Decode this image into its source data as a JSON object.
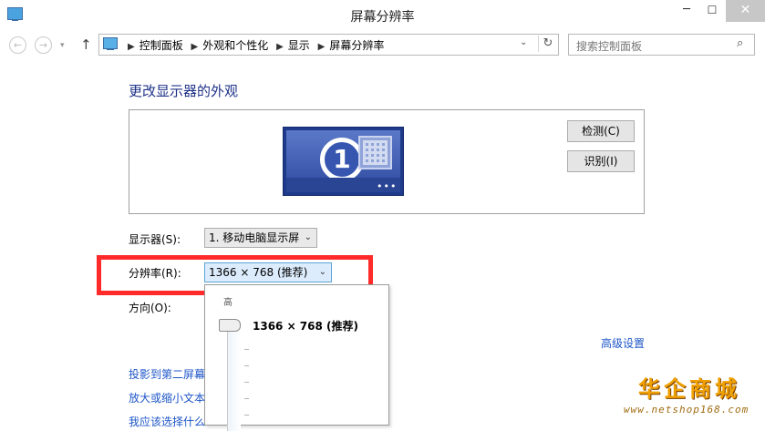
{
  "window": {
    "title": "屏幕分辨率",
    "min": "─",
    "max": "☐",
    "close": "✕"
  },
  "nav": {
    "breadcrumbs": [
      "控制面板",
      "外观和个性化",
      "显示",
      "屏幕分辨率"
    ],
    "search_placeholder": "搜索控制面板"
  },
  "main": {
    "heading": "更改显示器的外观",
    "monitor_number": "1",
    "detect_label": "检测(C)",
    "identify_label": "识别(I)",
    "display_label": "显示器(S):",
    "display_value": "1. 移动电脑显示屏",
    "resolution_label": "分辨率(R):",
    "resolution_value": "1366 × 768 (推荐)",
    "orientation_label": "方向(O):",
    "advanced_link": "高级设置",
    "links": [
      "投影到第二屏幕",
      "放大或缩小文本",
      "我应该选择什么"
    ]
  },
  "dropdown": {
    "top_label": "高",
    "current": "1366 × 768 (推荐)"
  },
  "watermark": {
    "title": "华企商城",
    "url": "www.netshop168.com"
  },
  "colors": {
    "heading": "#1e3287",
    "link": "#1e56c8",
    "highlight": "#ff2b2b"
  }
}
